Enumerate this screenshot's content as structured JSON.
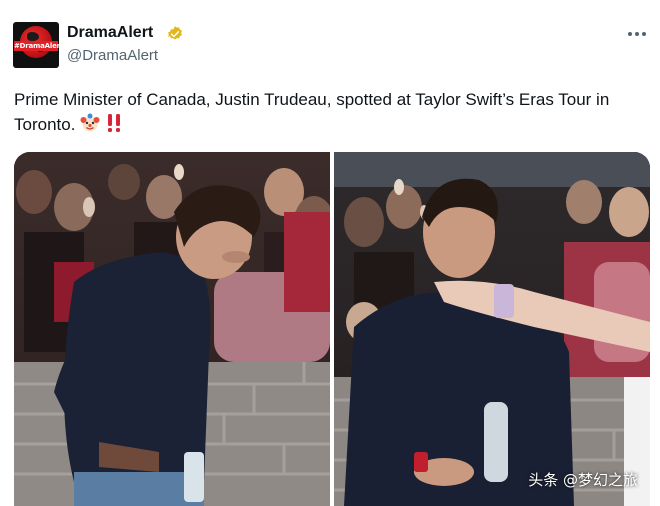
{
  "account": {
    "display_name": "DramaAlert",
    "handle": "@DramaAlert",
    "avatar_label": "#DramaAlert",
    "verified_color": "#e2b719"
  },
  "tweet": {
    "text": "Prime Minister of Canada, Justin Trudeau, spotted at Taylor Swift’s Eras Tour in Toronto.",
    "emojis": [
      "clown-face",
      "double-exclamation"
    ]
  },
  "media": {
    "photos": [
      "left-photo",
      "right-photo"
    ],
    "watermark": "头条 @梦幻之旅"
  },
  "icons": {
    "more": "more-options-icon",
    "verified": "verified-badge-icon"
  }
}
